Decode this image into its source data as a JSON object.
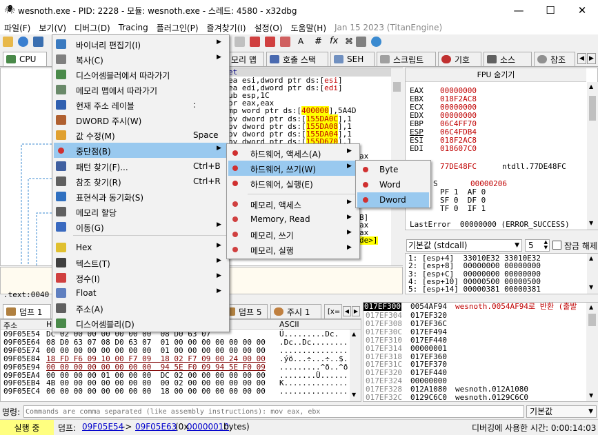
{
  "window": {
    "title": "wesnoth.exe - PID: 2228 - 모듈: wesnoth.exe - 스레드: 4580 - x32dbg"
  },
  "menubar": {
    "items": [
      "파일(F)",
      "보기(V)",
      "디버그(D)",
      "Tracing",
      "플러그인(P)",
      "즐겨찾기(I)",
      "설정(O)",
      "도움말(H)"
    ],
    "date": "Jan 15 2023 (TitanEngine)"
  },
  "tabs": {
    "cpu": "CPU",
    "memmap": "모리 맵",
    "callstack": "호출 스택",
    "seh": "SEH",
    "script": "스크립트",
    "symbols": "기호",
    "source": "소스",
    "refs": "참조"
  },
  "disasm": {
    "label_row": "et",
    "lines": [
      {
        "pre": "ea esi,dword ptr ds:[",
        "reg": "esi",
        "post": "]"
      },
      {
        "pre": "ea edi,dword ptr ds:[",
        "reg": "edi",
        "post": "]"
      },
      {
        "pre": "ub esp,1C",
        "reg": "",
        "post": ""
      },
      {
        "pre": "or eax,eax",
        "reg": "",
        "post": ""
      },
      {
        "pre": "mp word ptr ds:[",
        "reg": "400000",
        "post": "],5A4D"
      },
      {
        "pre": "ov dword ptr ds:[",
        "reg": "155DA0C",
        "post": "],1"
      },
      {
        "pre": "ov dword ptr ds:[",
        "reg": "155DA08",
        "post": "],1"
      },
      {
        "pre": "ov dword ptr ds:[",
        "reg": "155DA04",
        "post": "],1"
      },
      {
        "pre": "ov dword ptr ds:[",
        "reg": "155D670",
        "post": "],1"
      }
    ],
    "frag1": "ax",
    "frag2": "B]",
    "frag3": "ax",
    "frag4": "ax",
    "frag5": "de>]",
    "addr_line": ".text:0040"
  },
  "fpu": {
    "header": "FPU 숨기기",
    "registers": [
      {
        "name": "EAX",
        "value": "00000000"
      },
      {
        "name": "EBX",
        "value": "018F2AC8"
      },
      {
        "name": "ECX",
        "value": "00000000"
      },
      {
        "name": "EDX",
        "value": "00000000"
      },
      {
        "name": "EBP",
        "value": "06C4FF70"
      },
      {
        "name": "ESP",
        "value": "06C4FDB4"
      },
      {
        "name": "ESI",
        "value": "018F2AC8"
      },
      {
        "name": "EDI",
        "value": "018607C0"
      }
    ],
    "eip_value": "77DE48FC",
    "eip_sym": "ntdll.77DE48FC",
    "eflags_label": "S",
    "eflags_value": "00000206",
    "flags_rows": [
      "PF 1  AF 0",
      "SF 0  DF 0",
      "TF 0  IF 1"
    ],
    "lasterror": "LastError  00000000 (ERROR_SUCCESS)"
  },
  "callconv": {
    "select": "기본값 (stdcall)",
    "count": "5",
    "lock_label": "잠금 해제"
  },
  "args": [
    "1: [esp+4]  33010E32 33010E32",
    "2: [esp+8]  00000000 00000000",
    "3: [esp+C]  00000000 00000000",
    "4: [esp+10] 00000500 00000500",
    "5: [esp+14] 00000381 00000381"
  ],
  "dumptabs": {
    "dump1": "덤프 1",
    "dump5": "덤프 5",
    "watch1": "주시 1",
    "xs": "[x="
  },
  "dump": {
    "col_addr": "주소",
    "col_hex": "H",
    "col_ascii": "ASCII",
    "rows": [
      {
        "addr": "09F05E54",
        "hex": "DC 02 00 00 00 00 00 00  08 D0 63 07",
        "ascii": "Ü.........Dc."
      },
      {
        "addr": "09F05E64",
        "hex": "08 D0 63 07 08 D0 63 07  01 00 00 00 00 00 00 00",
        "ascii": ".Dc..Dc........"
      },
      {
        "addr": "09F05E74",
        "hex": "00 00 00 00 00 00 00 00  01 00 00 00 00 00 00 00",
        "ascii": "..............."
      },
      {
        "addr": "09F05E84",
        "hex": "18 FD F6 09 10 00 F7 09  18 02 F7 09 00 24 00 00",
        "ascii": ".ýö...÷...÷..$."
      },
      {
        "addr": "09F05E94",
        "hex": "00 00 00 00 00 00 00 00  94 5E F0 09 94 5E F0 09",
        "ascii": ".........^ð..^ð."
      },
      {
        "addr": "09F05EA4",
        "hex": "00 00 00 00 01 00 00 00  DC 02 00 00 00 00 00 00",
        "ascii": "........Ü......."
      },
      {
        "addr": "09F05EB4",
        "hex": "4B 00 00 00 00 00 00 00  00 02 00 00 00 00 00 00",
        "ascii": "K..............."
      },
      {
        "addr": "09F05EC4",
        "hex": "00 00 00 00 00 00 00 00  18 00 00 00 00 00 00 00",
        "ascii": "..............."
      }
    ]
  },
  "stack": {
    "top_addr": "017EF300",
    "top_val": "0054AF94",
    "top_comment": "wesnoth.0054AF94로 반환 (출발",
    "rows": [
      {
        "addr": "017EF304",
        "val": "017EF320",
        "comment": ""
      },
      {
        "addr": "017EF308",
        "val": "017EF36C",
        "comment": ""
      },
      {
        "addr": "017EF30C",
        "val": "017EF494",
        "comment": ""
      },
      {
        "addr": "017EF310",
        "val": "017EF440",
        "comment": ""
      },
      {
        "addr": "017EF314",
        "val": "00000001",
        "comment": ""
      },
      {
        "addr": "017EF318",
        "val": "017EF360",
        "comment": ""
      },
      {
        "addr": "017EF31C",
        "val": "017EF370",
        "comment": ""
      },
      {
        "addr": "017EF320",
        "val": "017EF440",
        "comment": ""
      },
      {
        "addr": "017EF324",
        "val": "00000000",
        "comment": ""
      },
      {
        "addr": "017EF328",
        "val": "012A1080",
        "comment": "wesnoth.012A1080"
      },
      {
        "addr": "017EF32C",
        "val": "0129C6C0",
        "comment": "wesnoth.0129C6C0"
      }
    ]
  },
  "command": {
    "label": "명령:",
    "placeholder": "Commands are comma separated (like assembly instructions): mov eax, ebx",
    "default": "기본값"
  },
  "status": {
    "state": "실행 중",
    "dump_label": "덤프:",
    "from": "09F05E54",
    "arrow": "->",
    "to": "09F05E63",
    "size_pre": "(0x",
    "size": "00000010",
    "size_post": "bytes)",
    "timer": "디버깅에 사용한 시간: 0:00:14:03"
  },
  "context_menu": {
    "items": [
      {
        "label": "바이너리 편집기(I)",
        "shortcut": "",
        "arrow": true
      },
      {
        "label": "복사(C)",
        "shortcut": "",
        "arrow": true
      },
      {
        "label": "디스어셈블러에서 따라가기",
        "shortcut": "",
        "arrow": false
      },
      {
        "label": "메모리 맵에서 따라가기",
        "shortcut": "",
        "arrow": false
      },
      {
        "label": "현재 주소 레이블",
        "shortcut": ":",
        "arrow": false
      },
      {
        "label": "DWORD 주시(W)",
        "shortcut": "",
        "arrow": false
      },
      {
        "label": "값 수정(M)",
        "shortcut": "Space",
        "arrow": false
      },
      {
        "label": "중단점(B)",
        "shortcut": "",
        "arrow": true
      },
      {
        "label": "패턴 찾기(F)...",
        "shortcut": "Ctrl+B",
        "arrow": false
      },
      {
        "label": "참조 찾기(R)",
        "shortcut": "Ctrl+R",
        "arrow": false
      },
      {
        "label": "표현식과 동기화(S)",
        "shortcut": "",
        "arrow": false
      },
      {
        "label": "메모리 할당",
        "shortcut": "",
        "arrow": false
      },
      {
        "label": "이동(G)",
        "shortcut": "",
        "arrow": true
      },
      {
        "label": "Hex",
        "shortcut": "",
        "arrow": true
      },
      {
        "label": "텍스트(T)",
        "shortcut": "",
        "arrow": true
      },
      {
        "label": "정수(I)",
        "shortcut": "",
        "arrow": true
      },
      {
        "label": "Float",
        "shortcut": "",
        "arrow": true
      },
      {
        "label": "주소(A)",
        "shortcut": "",
        "arrow": false
      },
      {
        "label": "디스어셈블리(D)",
        "shortcut": "",
        "arrow": false
      }
    ]
  },
  "bp_menu": {
    "items": [
      "하드웨어, 액세스(A)",
      "하드웨어, 쓰기(W)",
      "하드웨어, 실행(E)",
      "메모리, 액세스",
      "Memory, Read",
      "메모리, 쓰기",
      "메모리, 실행"
    ]
  },
  "size_menu": {
    "items": [
      "Byte",
      "Word",
      "Dword"
    ]
  }
}
